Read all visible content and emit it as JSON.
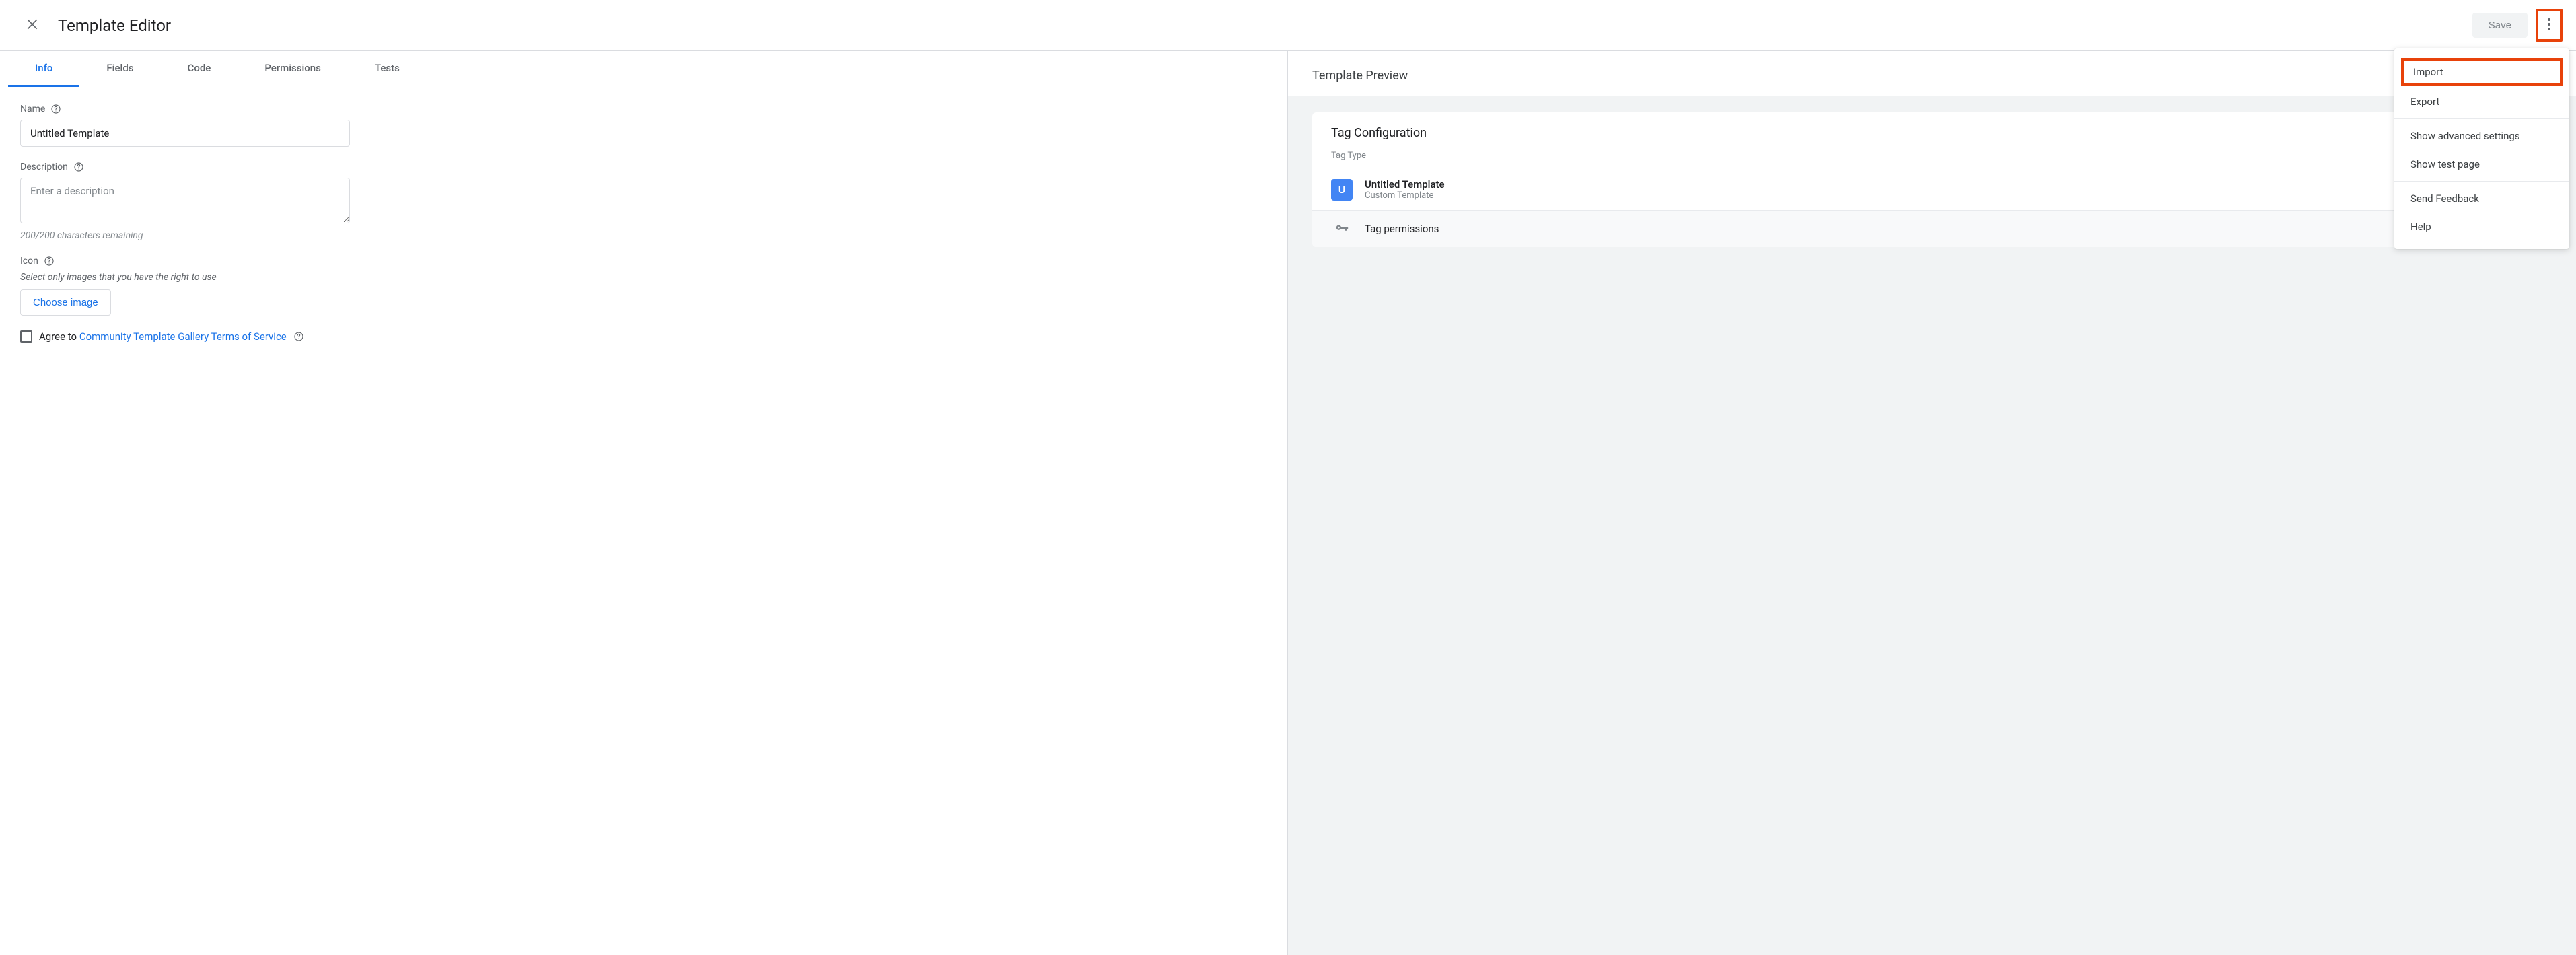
{
  "header": {
    "title": "Template Editor",
    "save_label": "Save"
  },
  "tabs": [
    "Info",
    "Fields",
    "Code",
    "Permissions",
    "Tests"
  ],
  "active_tab": 0,
  "form": {
    "name_label": "Name",
    "name_value": "Untitled Template",
    "description_label": "Description",
    "description_placeholder": "Enter a description",
    "description_value": "",
    "char_remaining": "200/200 characters remaining",
    "icon_label": "Icon",
    "icon_hint": "Select only images that you have the right to use",
    "choose_image_label": "Choose image",
    "agree_prefix": "Agree to ",
    "agree_link": "Community Template Gallery Terms of Service"
  },
  "preview": {
    "title": "Template Preview",
    "config_title": "Tag Configuration",
    "tag_type_label": "Tag Type",
    "tag_icon_letter": "U",
    "tag_name": "Untitled Template",
    "tag_subtitle": "Custom Template",
    "permissions_label": "Tag permissions"
  },
  "menu": {
    "import": "Import",
    "export": "Export",
    "advanced": "Show advanced settings",
    "test_page": "Show test page",
    "feedback": "Send Feedback",
    "help": "Help"
  }
}
